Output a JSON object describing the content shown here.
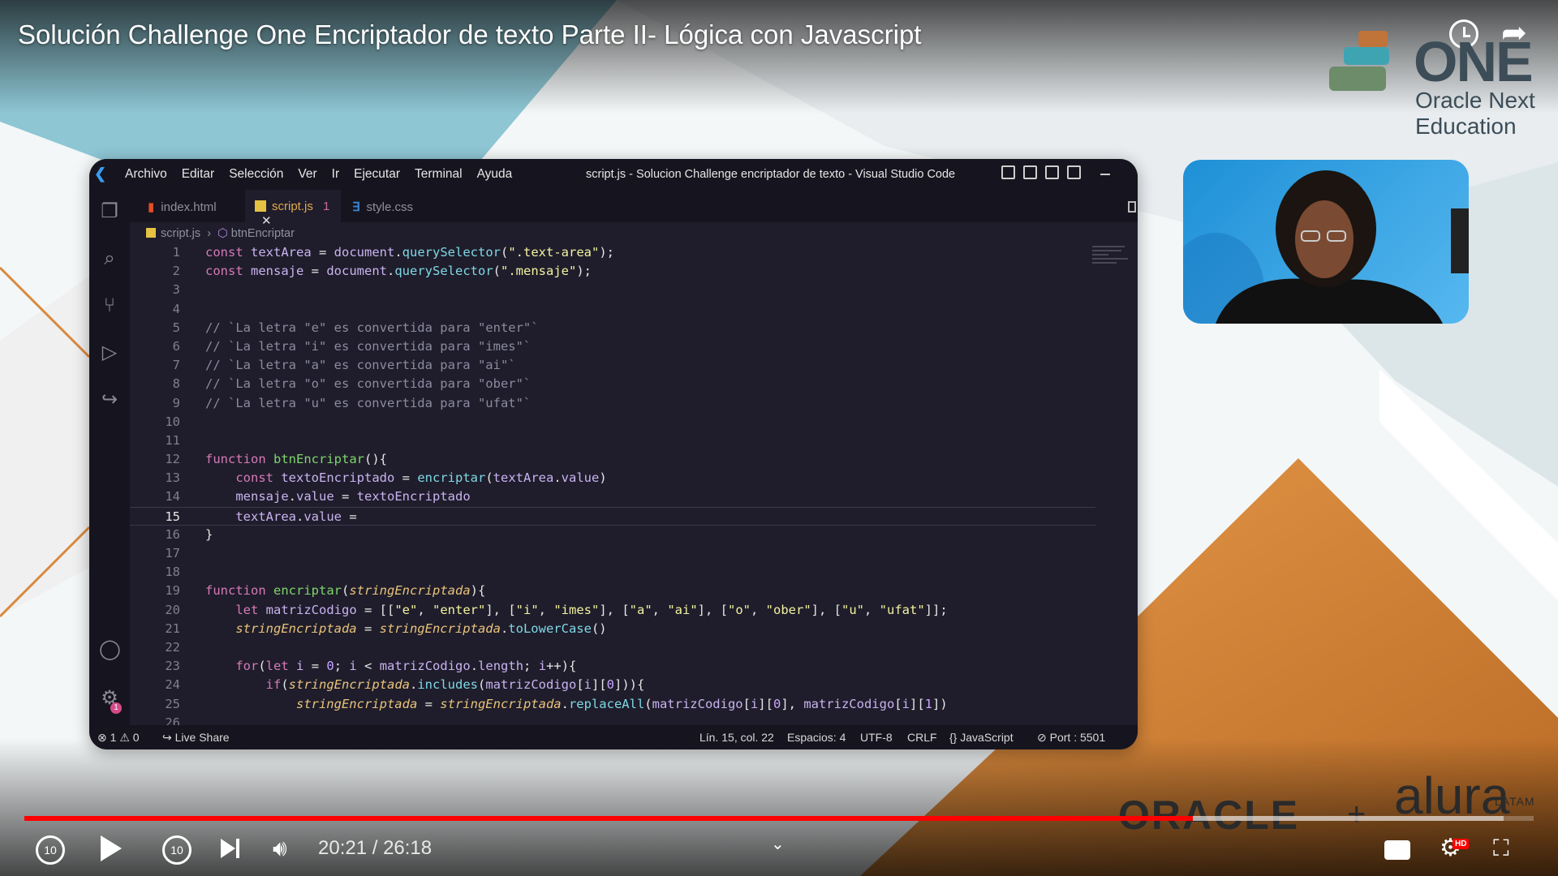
{
  "video": {
    "title": "Solución Challenge One Encriptador de texto Parte II- Lógica con Javascript",
    "time_display": "20:21 / 26:18",
    "progress_fraction": 0.774,
    "buffered_fraction": 0.98
  },
  "branding": {
    "one_word": "ONE",
    "one_line1": "Oracle Next",
    "one_line2": "Education",
    "oracle": "ORACLE",
    "plus": "+",
    "alura": "alura",
    "latam": "LATAM"
  },
  "vscode": {
    "menu": [
      "Archivo",
      "Editar",
      "Selección",
      "Ver",
      "Ir",
      "Ejecutar",
      "Terminal",
      "Ayuda"
    ],
    "window_title": "script.js - Solucion Challenge encriptador de texto - Visual Studio Code",
    "tabs": [
      {
        "label": "index.html",
        "icon": "html-icon"
      },
      {
        "label": "script.js",
        "badge": "1",
        "icon": "js-icon"
      },
      {
        "label": "style.css",
        "icon": "css-icon"
      }
    ],
    "breadcrumb_file": "script.js",
    "breadcrumb_symbol": "btnEncriptar",
    "status": {
      "errors": "1",
      "warnings": "0",
      "live_share": "Live Share",
      "position": "Lín. 15, col. 22",
      "spaces": "Espacios: 4",
      "encoding": "UTF-8",
      "eol": "CRLF",
      "language": "JavaScript",
      "port": "Port : 5501"
    },
    "current_line": 15,
    "code": [
      "const textArea = document.querySelector(\".text-area\");",
      "const mensaje = document.querySelector(\".mensaje\");",
      "",
      "",
      "// `La letra \"e\" es convertida para \"enter\"`",
      "// `La letra \"i\" es convertida para \"imes\"`",
      "// `La letra \"a\" es convertida para \"ai\"`",
      "// `La letra \"o\" es convertida para \"ober\"`",
      "// `La letra \"u\" es convertida para \"ufat\"`",
      "",
      "",
      "function btnEncriptar(){",
      "    const textoEncriptado = encriptar(textArea.value)",
      "    mensaje.value = textoEncriptado",
      "    textArea.value = ",
      "}",
      "",
      "",
      "function encriptar(stringEncriptada){",
      "    let matrizCodigo = [[\"e\", \"enter\"], [\"i\", \"imes\"], [\"a\", \"ai\"], [\"o\", \"ober\"], [\"u\", \"ufat\"]];",
      "    stringEncriptada = stringEncriptada.toLowerCase()",
      "",
      "    for(let i = 0; i < matrizCodigo.length; i++){",
      "        if(stringEncriptada.includes(matrizCodigo[i][0])){",
      "            stringEncriptada = stringEncriptada.replaceAll(matrizCodigo[i][0], matrizCodigo[i][1])",
      ""
    ]
  },
  "colors": {
    "progress": "#ff0000",
    "accent_orange": "#d9893e",
    "editor_bg": "#1f1d2b"
  }
}
